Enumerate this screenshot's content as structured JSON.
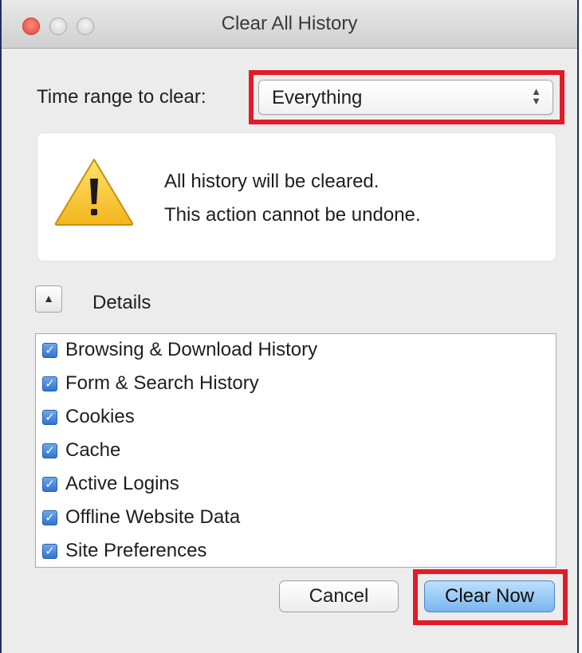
{
  "window": {
    "title": "Clear All History"
  },
  "time_range": {
    "label": "Time range to clear:",
    "selected": "Everything"
  },
  "warning": {
    "line1": "All history will be cleared.",
    "line2": "This action cannot be undone."
  },
  "details": {
    "label": "Details",
    "expanded": true
  },
  "items": [
    {
      "label": "Browsing & Download History",
      "checked": true
    },
    {
      "label": "Form & Search History",
      "checked": true
    },
    {
      "label": "Cookies",
      "checked": true
    },
    {
      "label": "Cache",
      "checked": true
    },
    {
      "label": "Active Logins",
      "checked": true
    },
    {
      "label": "Offline Website Data",
      "checked": true
    },
    {
      "label": "Site Preferences",
      "checked": true
    }
  ],
  "buttons": {
    "cancel": "Cancel",
    "clear_now": "Clear Now"
  },
  "colors": {
    "highlight": "#e11b28",
    "primary_button": "#78b6ef",
    "checkbox": "#2f74d0"
  }
}
